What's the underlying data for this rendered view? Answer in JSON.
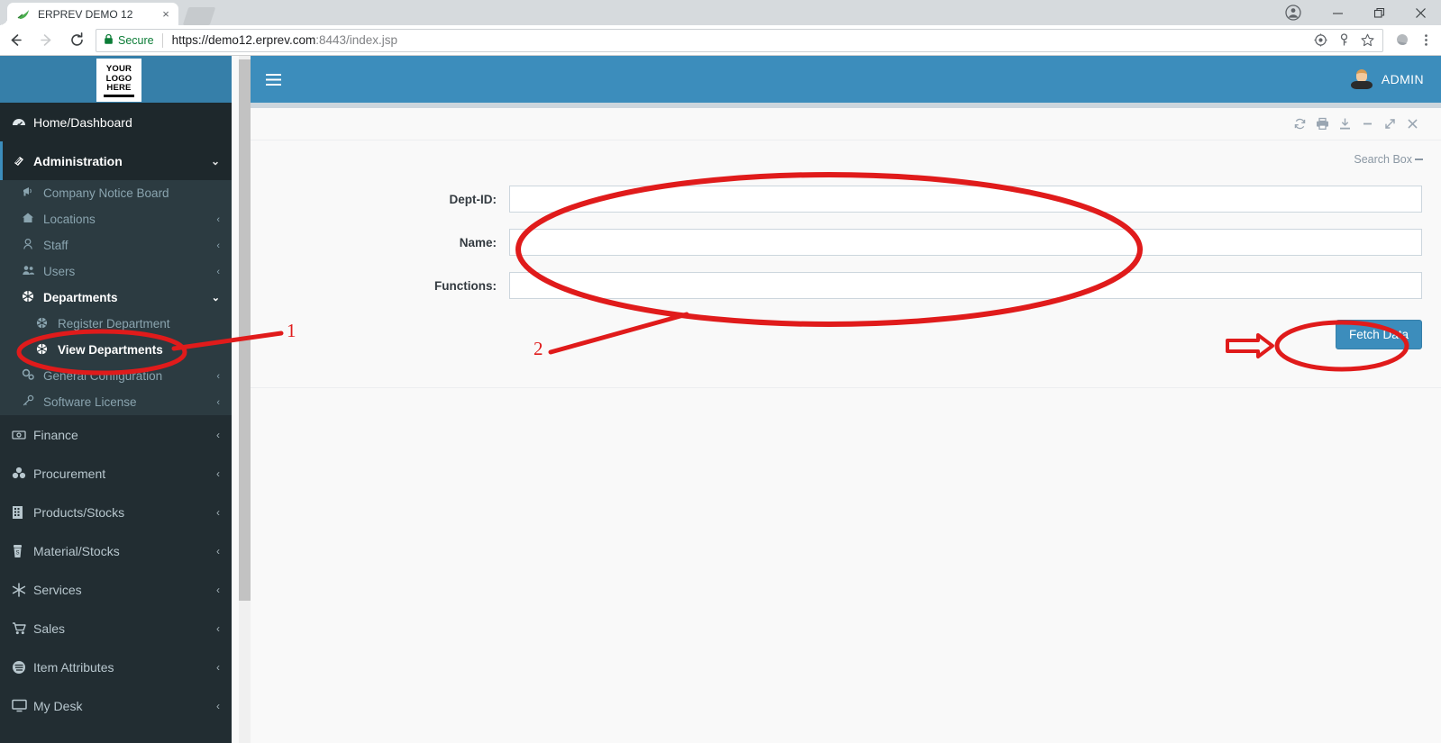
{
  "browser": {
    "tab": {
      "title": "ERPREV DEMO 12",
      "favicon": "leaf-icon",
      "close": "×"
    },
    "new_tab": "new-tab-button",
    "window_controls": {
      "profile": "●",
      "minimize": "—",
      "maximize": "❐",
      "close": "✕"
    },
    "nav": {
      "back": "←",
      "forward": "→",
      "reload": "⟳"
    },
    "omnibox": {
      "lock": "🔒",
      "secure_label": "Secure",
      "url_scheme": "https://",
      "url_host": "demo12.erprev.com",
      "url_rest": ":8443/index.jsp"
    },
    "omnibox_icons": {
      "target": "◎",
      "key": "⚷",
      "star": "☆"
    },
    "toolbar_icons": {
      "extension": "◕",
      "menu": "⋮"
    }
  },
  "app": {
    "logo": {
      "line1": "YOUR",
      "line2": "LOGO",
      "line3": "HERE"
    },
    "topbar": {
      "hamburger": "≡",
      "user_name": "ADMIN"
    }
  },
  "sidebar": {
    "items": [
      {
        "label": "Home/Dashboard",
        "icon": "dashboard-icon",
        "glyph": "⚈",
        "state": "home",
        "caret": ""
      },
      {
        "label": "Administration",
        "icon": "admin-icon",
        "glyph": "◧",
        "state": "active",
        "caret": "⌄"
      },
      {
        "label": "Finance",
        "icon": "finance-icon",
        "glyph": "▤",
        "state": "",
        "caret": "‹"
      },
      {
        "label": "Procurement",
        "icon": "procurement-icon",
        "glyph": "☸",
        "state": "",
        "caret": "‹"
      },
      {
        "label": "Products/Stocks",
        "icon": "products-icon",
        "glyph": "▦",
        "state": "",
        "caret": "‹"
      },
      {
        "label": "Material/Stocks",
        "icon": "material-icon",
        "glyph": "☗",
        "state": "",
        "caret": "‹"
      },
      {
        "label": "Services",
        "icon": "services-icon",
        "glyph": "❄",
        "state": "",
        "caret": "‹"
      },
      {
        "label": "Sales",
        "icon": "cart-icon",
        "glyph": "⛉",
        "state": "",
        "caret": "‹"
      },
      {
        "label": "Item Attributes",
        "icon": "attributes-icon",
        "glyph": "◔",
        "state": "",
        "caret": "‹"
      },
      {
        "label": "My Desk",
        "icon": "desk-icon",
        "glyph": "⬜",
        "state": "",
        "caret": "‹"
      }
    ],
    "admin_submenu": [
      {
        "label": "Company Notice Board",
        "icon": "megaphone-icon",
        "glyph": "✐",
        "caret": "",
        "level": 1,
        "selected": false
      },
      {
        "label": "Locations",
        "icon": "home-icon",
        "glyph": "⌂",
        "caret": "‹",
        "level": 1,
        "selected": false
      },
      {
        "label": "Staff",
        "icon": "person-icon",
        "glyph": "⚲",
        "caret": "‹",
        "level": 1,
        "selected": false
      },
      {
        "label": "Users",
        "icon": "users-icon",
        "glyph": "⛟",
        "caret": "‹",
        "level": 1,
        "selected": false
      },
      {
        "label": "Departments",
        "icon": "department-icon",
        "glyph": "✸",
        "caret": "⌄",
        "level": 1,
        "selected": true
      },
      {
        "label": "Register Department",
        "icon": "department-icon",
        "glyph": "✸",
        "caret": "",
        "level": 2,
        "selected": false
      },
      {
        "label": "View Departments",
        "icon": "department-icon",
        "glyph": "✸",
        "caret": "",
        "level": 2,
        "selected": true
      },
      {
        "label": "General Configuration",
        "icon": "gears-icon",
        "glyph": "⚙",
        "caret": "‹",
        "level": 1,
        "selected": false
      },
      {
        "label": "Software License",
        "icon": "key-icon",
        "glyph": "⚷",
        "caret": "‹",
        "level": 1,
        "selected": false
      }
    ]
  },
  "panel": {
    "tools": [
      {
        "name": "refresh-icon",
        "glyph": "⟳"
      },
      {
        "name": "print-icon",
        "glyph": "⎙"
      },
      {
        "name": "download-icon",
        "glyph": "⤓"
      },
      {
        "name": "minimize-icon",
        "glyph": "—"
      },
      {
        "name": "expand-icon",
        "glyph": "↗"
      },
      {
        "name": "close-icon",
        "glyph": "✕"
      }
    ],
    "search_box_label": "Search Box",
    "form": {
      "fields": [
        {
          "label": "Dept-ID:",
          "value": "",
          "placeholder": "",
          "name": "dept-id-field"
        },
        {
          "label": "Name:",
          "value": "",
          "placeholder": "",
          "name": "name-field"
        },
        {
          "label": "Functions:",
          "value": "",
          "placeholder": "",
          "name": "functions-field"
        }
      ],
      "submit_label": "Fetch Data"
    }
  },
  "annotations": {
    "color": "#e01b1b",
    "marker_1": "1",
    "marker_2": "2"
  },
  "colors": {
    "sidebar_bg": "#222d32",
    "sidebar_active": "#1e282c",
    "submenu_bg": "#2c3b41",
    "accent_blue": "#3c8dbc",
    "header_blue": "#367fa9",
    "annotation_red": "#e01b1b"
  }
}
